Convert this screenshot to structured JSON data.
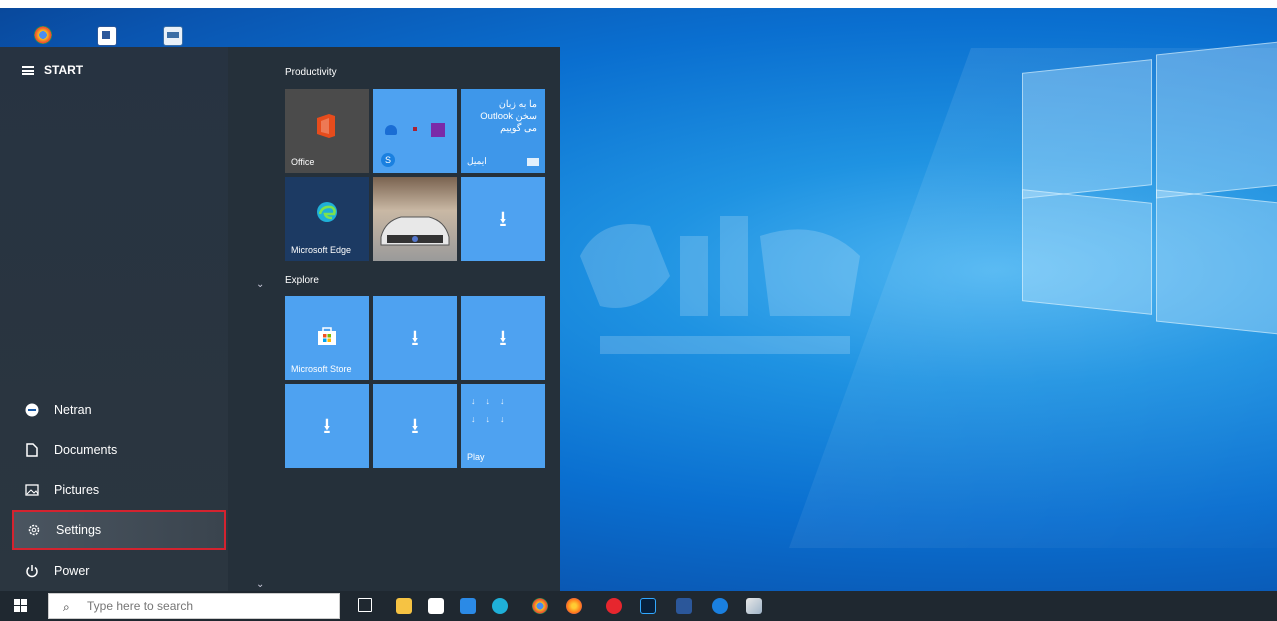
{
  "desktop": {
    "icons": [
      "chrome-icon",
      "word-document-icon",
      "window-app-icon"
    ]
  },
  "start_menu": {
    "title": "START",
    "nav_items": [
      {
        "label": "Netran",
        "icon": "account-icon"
      },
      {
        "label": "Documents",
        "icon": "document-icon"
      },
      {
        "label": "Pictures",
        "icon": "pictures-icon"
      },
      {
        "label": "Settings",
        "icon": "gear-icon",
        "highlighted": true
      },
      {
        "label": "Power",
        "icon": "power-icon"
      }
    ],
    "groups": [
      {
        "title": "Productivity"
      },
      {
        "title": "Explore"
      }
    ],
    "tiles": {
      "office": "Office",
      "mail_line1": "ما به زبان",
      "mail_line2": "Outlook سخن",
      "mail_line3": "می گوییم",
      "mail_label": "ایمیل",
      "edge": "Microsoft Edge",
      "store": "Microsoft Store",
      "play": "Play"
    }
  },
  "taskbar": {
    "search_placeholder": "Type here to search",
    "pinned": [
      "task-view-icon",
      "file-explorer-icon",
      "store-icon",
      "mail-icon",
      "edge-icon",
      "chrome-icon",
      "firefox-icon",
      "opera-icon",
      "photoshop-icon",
      "word-icon",
      "skype-icon",
      "notepad-icon"
    ]
  },
  "colors": {
    "tile_blue": "#4ea2f1",
    "start_bg": "#25303a",
    "highlight_border": "#d4232f",
    "taskbar_bg": "#1f2830"
  }
}
